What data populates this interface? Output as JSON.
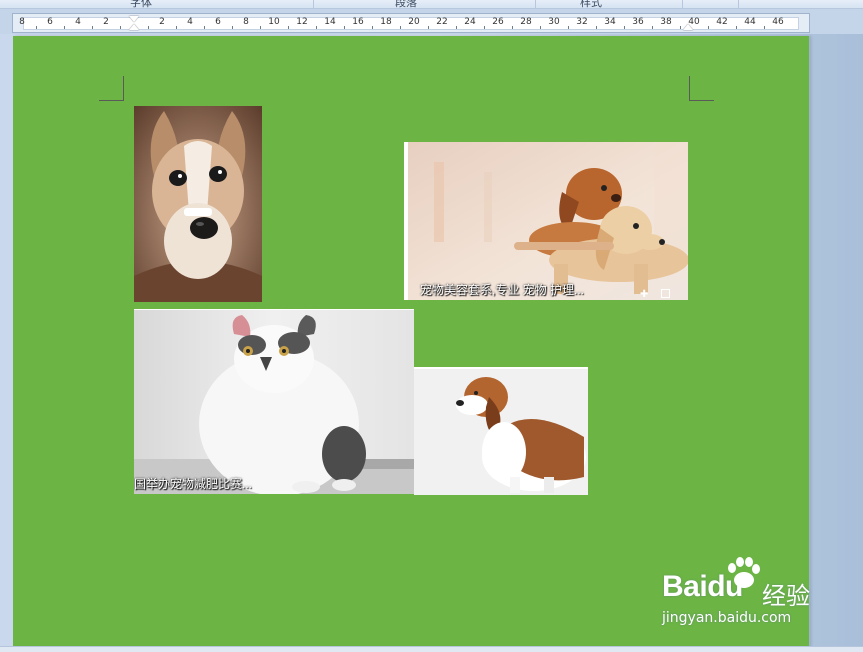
{
  "ribbon": {
    "groups": [
      "字体",
      "段落",
      "样式"
    ]
  },
  "ruler": {
    "labels": [
      "8",
      "6",
      "4",
      "2",
      "",
      "2",
      "4",
      "6",
      "8",
      "10",
      "12",
      "14",
      "16",
      "18",
      "20",
      "22",
      "24",
      "26",
      "28",
      "30",
      "32",
      "34",
      "36",
      "38",
      "40",
      "42",
      "44",
      "46"
    ]
  },
  "document": {
    "images": [
      {
        "name": "dog-portrait",
        "caption": ""
      },
      {
        "name": "two-puppies",
        "caption": "宠物美容套系,专业 宠物 护理..."
      },
      {
        "name": "fat-cat",
        "caption": "国举办宠物减肥比赛..."
      },
      {
        "name": "basset-hound",
        "caption": ""
      }
    ]
  },
  "watermark": {
    "logo": "Bai",
    "logo2": "du",
    "cn": "经验",
    "url": "jingyan.baidu.com"
  },
  "colors": {
    "page": "#6cb545",
    "workspace": "#c9d8ec",
    "ruler": "#e4ecf6"
  }
}
